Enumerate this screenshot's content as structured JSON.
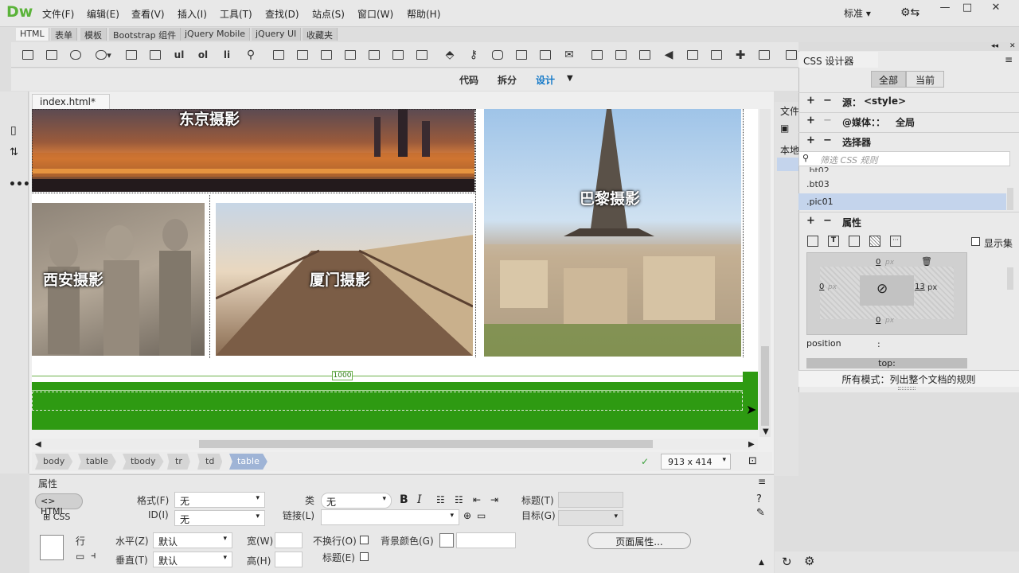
{
  "app": {
    "logo": "Dw",
    "workspace": "标准 ▾"
  },
  "menu": [
    "文件(F)",
    "编辑(E)",
    "查看(V)",
    "插入(I)",
    "工具(T)",
    "查找(D)",
    "站点(S)",
    "窗口(W)",
    "帮助(H)"
  ],
  "insert_tabs": [
    "HTML",
    "表单",
    "模板",
    "Bootstrap 组件",
    "jQuery Mobile",
    "jQuery UI",
    "收藏夹"
  ],
  "toolbar_text": {
    "ul": "ul",
    "ol": "ol",
    "li": "li"
  },
  "view_buttons": {
    "code": "代码",
    "split": "拆分",
    "design": "设计"
  },
  "document": {
    "tab_name": "index.html*",
    "captions": {
      "tokyo": "东京摄影",
      "paris": "巴黎摄影",
      "xian": "西安摄影",
      "xiamen": "厦门摄影"
    },
    "ruler_width": "1000"
  },
  "tag_selector": [
    "body",
    "table",
    "tbody",
    "tr",
    "td",
    "table"
  ],
  "window_size": "913 x 414",
  "properties": {
    "title": "属性",
    "html_btn": "HTML",
    "css_btn": "CSS",
    "format_label": "格式(F)",
    "format_value": "无",
    "id_label": "ID(I)",
    "id_value": "无",
    "class_label": "类",
    "class_value": "无",
    "link_label": "链接(L)",
    "title_label": "标题(T)",
    "target_label": "目标(G)",
    "row_label": "行",
    "horz_label": "水平(Z)",
    "horz_value": "默认",
    "vert_label": "垂直(T)",
    "vert_value": "默认",
    "width_label": "宽(W)",
    "height_label": "高(H)",
    "nowrap_label": "不换行(O)",
    "header_label": "标题(E)",
    "bg_label": "背景颜色(G)",
    "page_props_btn": "页面属性..."
  },
  "css_designer": {
    "title": "CSS 设计器",
    "tab_all": "全部",
    "tab_current": "当前",
    "source_label": "源：",
    "source_value": "<style>",
    "media_label": "@媒体：：",
    "media_value": "全局",
    "selector_label": "选择器",
    "filter_placeholder": "筛选 CSS 规则",
    "selectors": [
      ".bt02",
      ".bt03",
      ".pic01"
    ],
    "properties_label": "属性",
    "show_set": "显示集",
    "box": {
      "top": "0",
      "bottom": "0",
      "left": "0",
      "right": "13",
      "unit": "px"
    },
    "position_label": "position",
    "position_sep": ":",
    "top_label": "top:",
    "status": "所有模式：列出整个文档的规则"
  },
  "files_panel": {
    "tab": "文件",
    "local": "本地"
  }
}
